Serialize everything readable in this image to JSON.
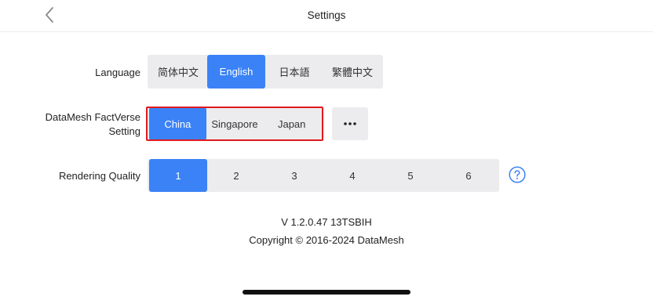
{
  "header": {
    "title": "Settings",
    "back_icon": "chevron-left-icon"
  },
  "language": {
    "label": "Language",
    "options": [
      "简体中文",
      "English",
      "日本語",
      "繁體中文"
    ],
    "selected": "English"
  },
  "region": {
    "label_line1": "DataMesh FactVerse",
    "label_line2": "Setting",
    "options": [
      "China",
      "Singapore",
      "Japan"
    ],
    "selected": "China",
    "more_icon": "ellipsis-icon",
    "highlight_color": "#e0191f"
  },
  "quality": {
    "label": "Rendering Quality",
    "options": [
      "1",
      "2",
      "3",
      "4",
      "5",
      "6"
    ],
    "selected": "1",
    "help_icon": "question-circle-icon"
  },
  "footer": {
    "version": "V 1.2.0.47 13TSBIH",
    "copyright": "Copyright © 2016-2024 DataMesh"
  },
  "colors": {
    "accent": "#3b82f6",
    "segment_bg": "#ececee",
    "highlight": "#e0191f"
  }
}
